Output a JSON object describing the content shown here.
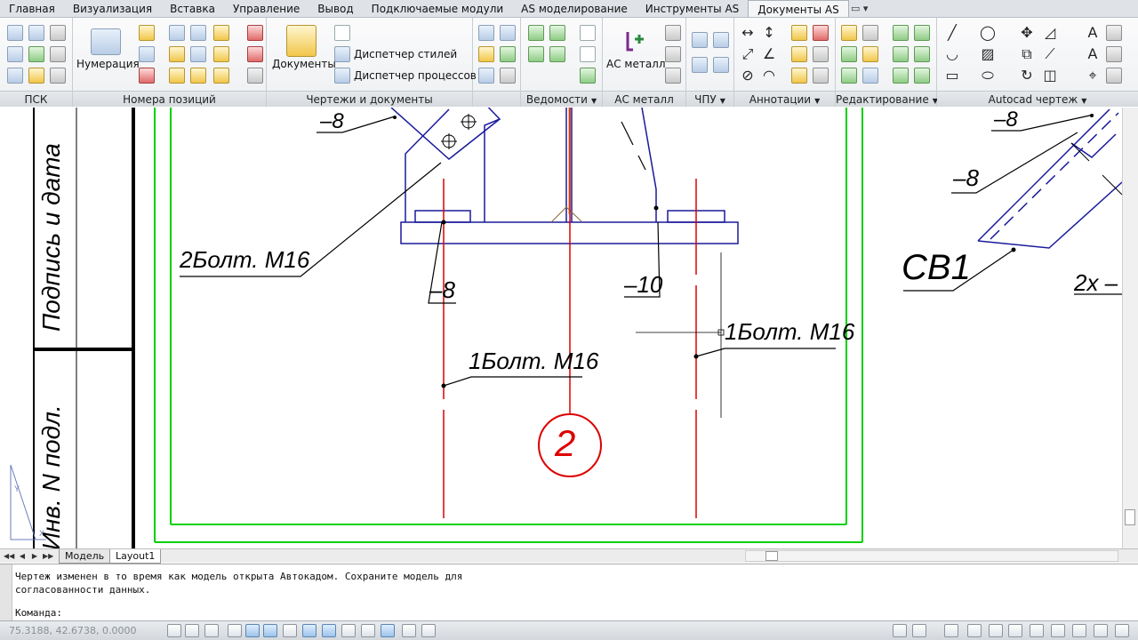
{
  "ribbon_tabs": [
    "Главная",
    "Визуализация",
    "Вставка",
    "Управление",
    "Вывод",
    "Подключаемые модули",
    "AS моделирование",
    "Инструменты AS",
    "Документы AS"
  ],
  "ribbon_tab_extra": "▭ ▾",
  "panels": {
    "psk": "ПСК",
    "positions": "Номера позиций",
    "drawings": "Чертежи и документы",
    "statements": "Ведомости",
    "as_metal": "АС металл",
    "chpu": "ЧПУ",
    "annotations": "Аннотации",
    "editing": "Редактирование",
    "autocad": "Autocad чертеж"
  },
  "buttons": {
    "numbering": "Нумерация",
    "documents": "Документы",
    "style_manager": "Диспетчер стилей",
    "process_manager": "Диспетчер процессов",
    "as_metal": "АС металл"
  },
  "drawing": {
    "leader_8_top": "–8",
    "bolt_2": "2Болт. М16",
    "leader_8_mid": "–8",
    "leader_10": "–10",
    "bolt_1_left": "1Болт. М16",
    "bolt_1_right": "1Болт. М16",
    "axis_mark": "2",
    "leader_8_right_top": "–8",
    "leader_8_right": "–8",
    "cb1": "СВ1",
    "label_2x": "2х –",
    "stamp_sign": "Подпись и дата",
    "stamp_inv": "Инв. N подл."
  },
  "layout_tabs": [
    "Модель",
    "Layout1"
  ],
  "command": {
    "message_line1": "Чертеж изменен в то время как модель открыта Автокадом. Сохраните модель для",
    "message_line2": "согласованности данных.",
    "prompt": "Команда:"
  },
  "status": {
    "coords": "75.3188, 42.6738, 0.0000"
  }
}
